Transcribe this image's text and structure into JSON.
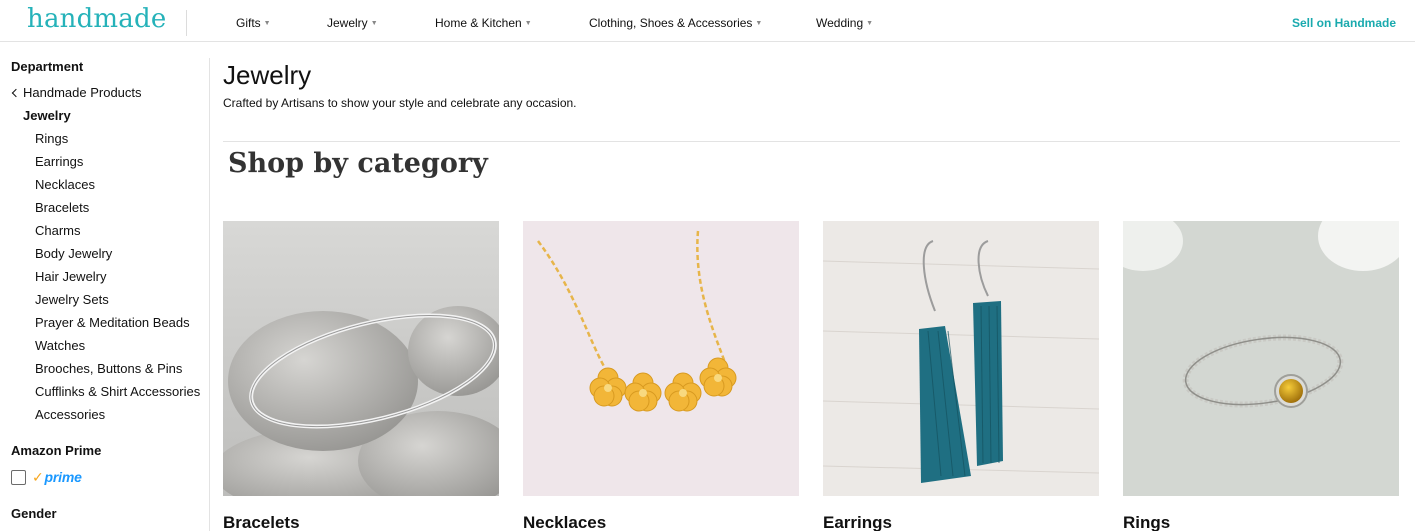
{
  "nav": {
    "logo": "handmade",
    "items": [
      {
        "label": "Gifts"
      },
      {
        "label": "Jewelry"
      },
      {
        "label": "Home & Kitchen"
      },
      {
        "label": "Clothing, Shoes & Accessories"
      },
      {
        "label": "Wedding"
      }
    ],
    "sell": "Sell on Handmade"
  },
  "sidebar": {
    "department_heading": "Department",
    "back_link": "Handmade Products",
    "current": "Jewelry",
    "subcategories": [
      "Rings",
      "Earrings",
      "Necklaces",
      "Bracelets",
      "Charms",
      "Body Jewelry",
      "Hair Jewelry",
      "Jewelry Sets",
      "Prayer & Meditation Beads",
      "Watches",
      "Brooches, Buttons & Pins",
      "Cufflinks & Shirt Accessories",
      "Accessories"
    ],
    "prime_heading": "Amazon Prime",
    "prime_logo_text": "prime",
    "gender_heading": "Gender"
  },
  "main": {
    "title": "Jewelry",
    "subtitle": "Crafted by Artisans to show your style and celebrate any occasion.",
    "shop_heading": "Shop by category",
    "categories": [
      {
        "label": "Bracelets"
      },
      {
        "label": "Necklaces"
      },
      {
        "label": "Earrings"
      },
      {
        "label": "Rings"
      }
    ]
  },
  "colors": {
    "brand_teal": "#25b2b9",
    "prime_blue": "#1a98ff",
    "prime_check": "#f7a61c"
  }
}
